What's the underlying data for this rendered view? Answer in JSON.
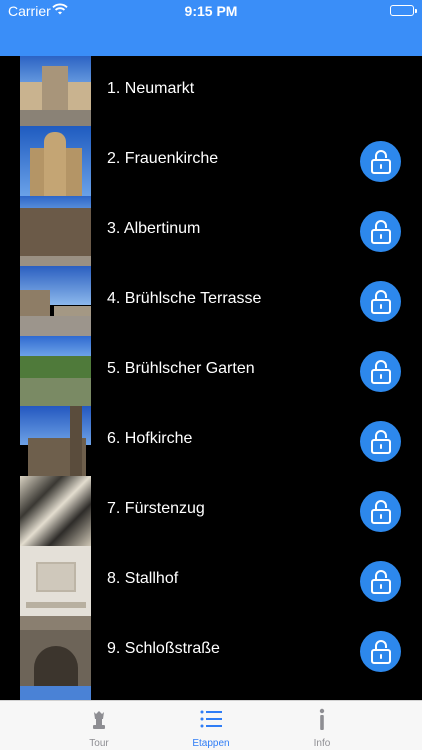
{
  "status": {
    "carrier": "Carrier",
    "time": "9:15 PM"
  },
  "colors": {
    "accent": "#3a8ef8",
    "lock": "#2d88ec",
    "tab_active": "#2f7df6",
    "tab_inactive": "#8e8e93"
  },
  "stages": [
    {
      "label": "1. Neumarkt",
      "locked": false,
      "icon": "photo"
    },
    {
      "label": "2. Frauenkirche",
      "locked": true,
      "icon": "lock-icon"
    },
    {
      "label": "3. Albertinum",
      "locked": true,
      "icon": "lock-icon"
    },
    {
      "label": "4. Brühlsche Terrasse",
      "locked": true,
      "icon": "lock-icon"
    },
    {
      "label": "5. Brühlscher Garten",
      "locked": true,
      "icon": "lock-icon"
    },
    {
      "label": "6. Hofkirche",
      "locked": true,
      "icon": "lock-icon"
    },
    {
      "label": "7. Fürstenzug",
      "locked": true,
      "icon": "lock-icon"
    },
    {
      "label": "8. Stallhof",
      "locked": true,
      "icon": "lock-icon"
    },
    {
      "label": "9. Schloßstraße",
      "locked": true,
      "icon": "lock-icon"
    }
  ],
  "tabs": [
    {
      "label": "Tour",
      "icon": "chess-piece-icon",
      "active": false
    },
    {
      "label": "Etappen",
      "icon": "list-icon",
      "active": true
    },
    {
      "label": "Info",
      "icon": "info-icon",
      "active": false
    }
  ]
}
